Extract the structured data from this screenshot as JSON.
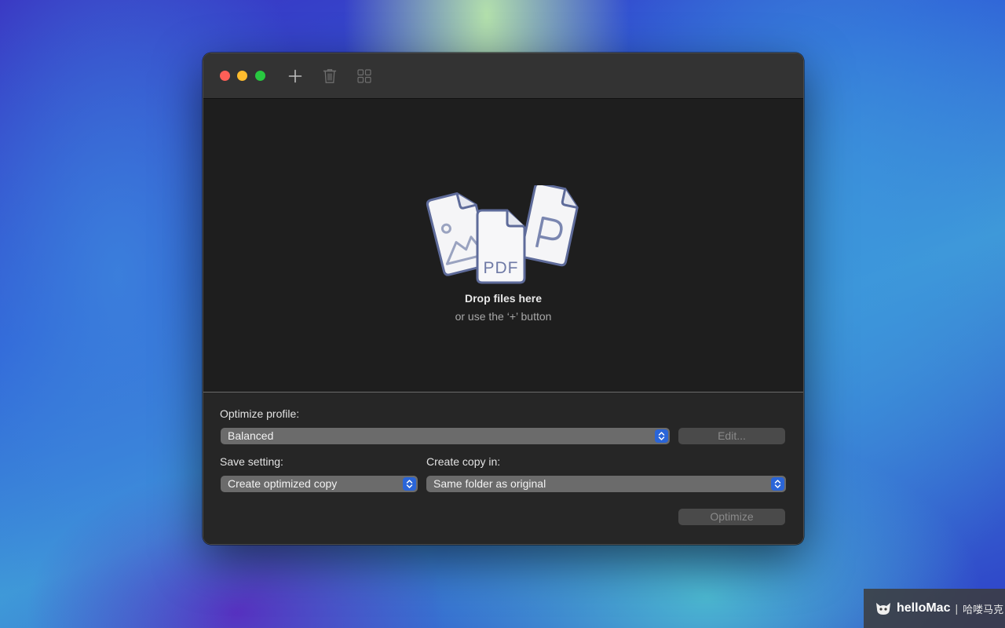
{
  "toolbar": {
    "add_icon": "plus-icon",
    "trash_icon": "trash-icon",
    "grid_icon": "grid-view-icon"
  },
  "dropzone": {
    "title": "Drop files here",
    "subtitle": "or use the ‘+’ button",
    "art_icons": [
      "image-file-icon",
      "pdf-file-icon",
      "p-file-icon"
    ],
    "pdf_label": "PDF",
    "p_label": "P"
  },
  "settings": {
    "profile_label": "Optimize profile:",
    "profile_value": "Balanced",
    "edit_label": "Edit...",
    "save_label": "Save setting:",
    "save_value": "Create optimized copy",
    "copy_label": "Create copy in:",
    "copy_value": "Same folder as original",
    "optimize_label": "Optimize"
  },
  "watermark": {
    "brand": "helloMac",
    "separator": "|",
    "cn": "哈喽马克"
  },
  "colors": {
    "accent": "#2a65d8",
    "close": "#fe5f57",
    "minimize": "#febc2e",
    "maximize": "#28c840",
    "window_bg": "#1e1e1e",
    "titlebar_bg": "#333333"
  }
}
